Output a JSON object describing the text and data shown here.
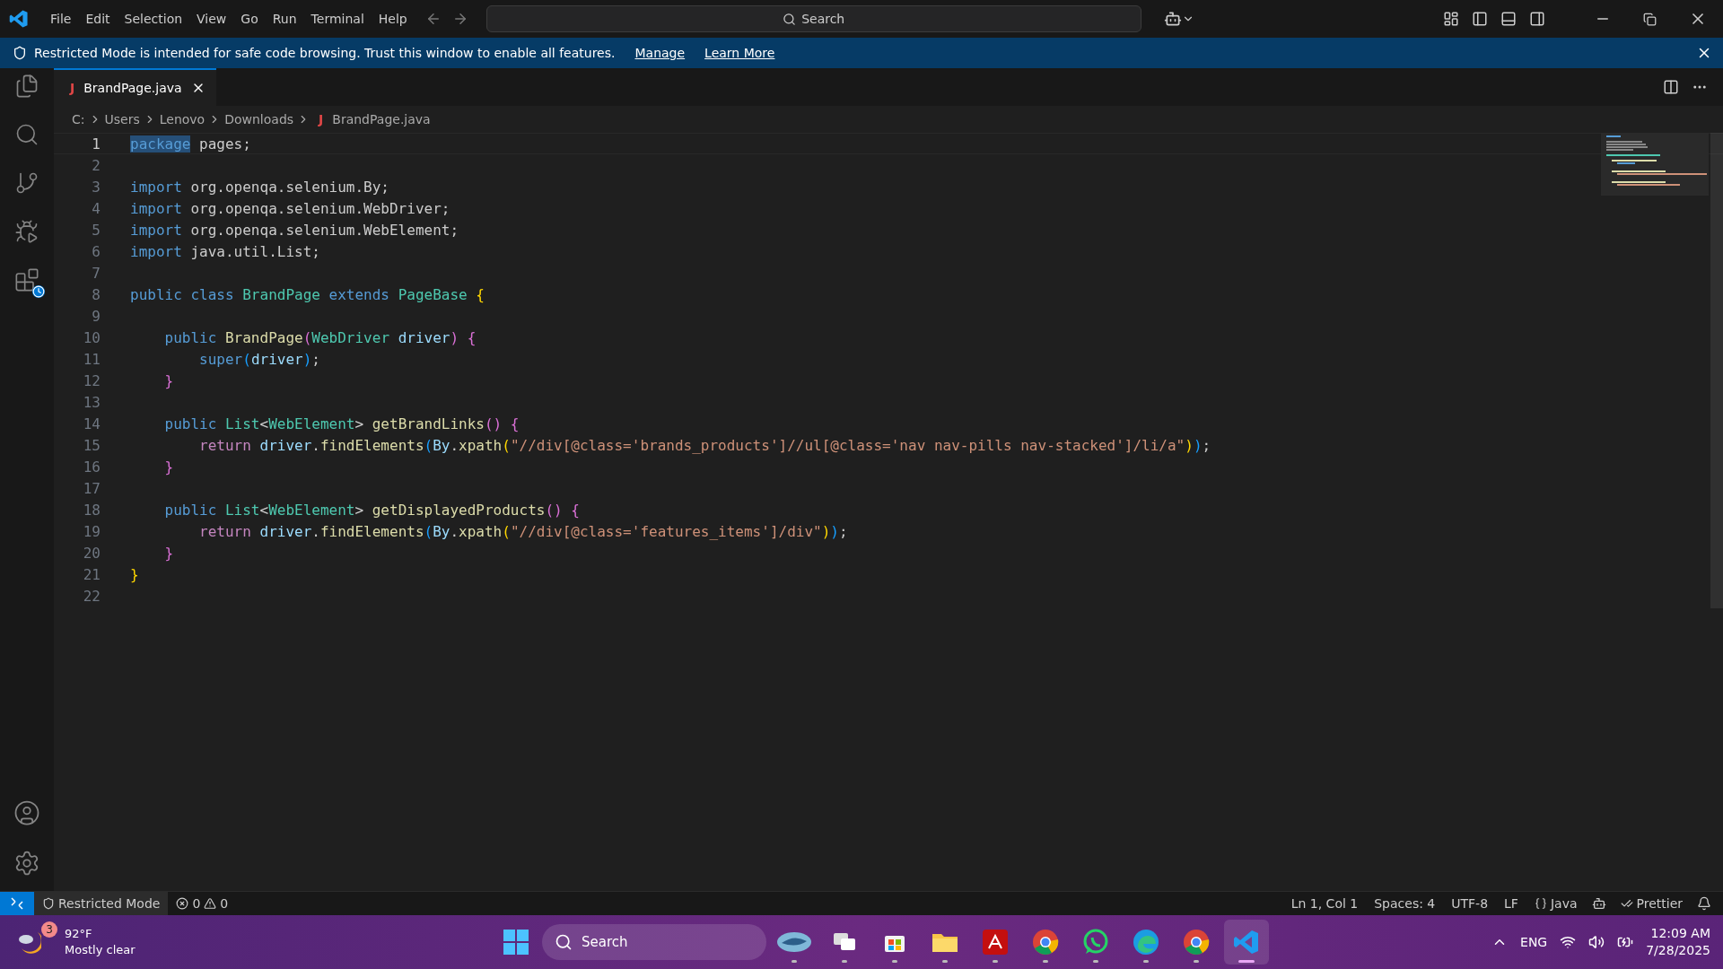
{
  "title_bar": {
    "menu": [
      "File",
      "Edit",
      "Selection",
      "View",
      "Go",
      "Run",
      "Terminal",
      "Help"
    ],
    "search": {
      "placeholder": "Search"
    }
  },
  "banner": {
    "message": "Restricted Mode is intended for safe code browsing. Trust this window to enable all features.",
    "links": [
      "Manage",
      "Learn More"
    ]
  },
  "tabs": [
    {
      "badge": "J",
      "label": "BrandPage.java",
      "selected": true
    }
  ],
  "breadcrumbs": {
    "folders": [
      "C:",
      "Users",
      "Lenovo",
      "Downloads"
    ],
    "file_badge": "J",
    "file": "BrandPage.java"
  },
  "editor": {
    "lines": [
      {
        "number": "1",
        "current": true,
        "tokens": [
          {
            "kind": "kw_sel",
            "text": "package"
          },
          {
            "kind": "pl",
            "text": " pages;"
          }
        ]
      },
      {
        "number": "2",
        "current": false
      },
      {
        "number": "3",
        "current": false,
        "tokens": [
          {
            "kind": "kw",
            "text": "import"
          },
          {
            "kind": "pl",
            "text": " org.openqa.selenium.By;"
          }
        ]
      },
      {
        "number": "4",
        "current": false,
        "tokens": [
          {
            "kind": "kw",
            "text": "import"
          },
          {
            "kind": "pl",
            "text": " org.openqa.selenium.WebDriver;"
          }
        ]
      },
      {
        "number": "5",
        "current": false,
        "tokens": [
          {
            "kind": "kw",
            "text": "import"
          },
          {
            "kind": "pl",
            "text": " org.openqa.selenium.WebElement;"
          }
        ]
      },
      {
        "number": "6",
        "current": false,
        "tokens": [
          {
            "kind": "kw",
            "text": "import"
          },
          {
            "kind": "pl",
            "text": " java.util.List;"
          }
        ]
      },
      {
        "number": "7",
        "current": false
      },
      {
        "number": "8",
        "current": false,
        "tokens": [
          {
            "kind": "kw",
            "text": "public class "
          },
          {
            "kind": "type",
            "text": "BrandPage"
          },
          {
            "kind": "kw",
            "text": " extends "
          },
          {
            "kind": "type",
            "text": "PageBase "
          },
          {
            "kind": "b1",
            "text": "{"
          }
        ]
      },
      {
        "number": "9",
        "current": false
      },
      {
        "number": "10",
        "current": false,
        "tokens": [
          {
            "kind": "kw",
            "text": "    public "
          },
          {
            "kind": "fn",
            "text": "BrandPage"
          },
          {
            "kind": "b2",
            "text": "("
          },
          {
            "kind": "type",
            "text": "WebDriver "
          },
          {
            "kind": "var",
            "text": "driver"
          },
          {
            "kind": "b2",
            "text": ") {"
          }
        ]
      },
      {
        "number": "11",
        "current": false,
        "tokens": [
          {
            "kind": "kw",
            "text": "        super"
          },
          {
            "kind": "b3",
            "text": "("
          },
          {
            "kind": "var",
            "text": "driver"
          },
          {
            "kind": "b3",
            "text": ")"
          },
          {
            "kind": "pl",
            "text": ";"
          }
        ]
      },
      {
        "number": "12",
        "current": false,
        "tokens": [
          {
            "kind": "b2",
            "text": "    }"
          }
        ]
      },
      {
        "number": "13",
        "current": false
      },
      {
        "number": "14",
        "current": false,
        "tokens": [
          {
            "kind": "kw",
            "text": "    public "
          },
          {
            "kind": "type",
            "text": "List"
          },
          {
            "kind": "pl",
            "text": "<"
          },
          {
            "kind": "type",
            "text": "WebElement"
          },
          {
            "kind": "pl",
            "text": "> "
          },
          {
            "kind": "fn",
            "text": "getBrandLinks"
          },
          {
            "kind": "b2",
            "text": "() {"
          }
        ]
      },
      {
        "number": "15",
        "current": false,
        "tokens": [
          {
            "kind": "ctl",
            "text": "        return "
          },
          {
            "kind": "var",
            "text": "driver"
          },
          {
            "kind": "pl",
            "text": "."
          },
          {
            "kind": "fn",
            "text": "findElements"
          },
          {
            "kind": "b3",
            "text": "("
          },
          {
            "kind": "var",
            "text": "By"
          },
          {
            "kind": "pl",
            "text": "."
          },
          {
            "kind": "fn",
            "text": "xpath"
          },
          {
            "kind": "b1",
            "text": "("
          },
          {
            "kind": "str",
            "text": "\"//div[@class='brands_products']//ul[@class='nav nav-pills nav-stacked']/li/a\""
          },
          {
            "kind": "b1",
            "text": ")"
          },
          {
            "kind": "b3",
            "text": ")"
          },
          {
            "kind": "pl",
            "text": ";"
          }
        ]
      },
      {
        "number": "16",
        "current": false,
        "tokens": [
          {
            "kind": "b2",
            "text": "    }"
          }
        ]
      },
      {
        "number": "17",
        "current": false
      },
      {
        "number": "18",
        "current": false,
        "tokens": [
          {
            "kind": "kw",
            "text": "    public "
          },
          {
            "kind": "type",
            "text": "List"
          },
          {
            "kind": "pl",
            "text": "<"
          },
          {
            "kind": "type",
            "text": "WebElement"
          },
          {
            "kind": "pl",
            "text": "> "
          },
          {
            "kind": "fn",
            "text": "getDisplayedProducts"
          },
          {
            "kind": "b2",
            "text": "() {"
          }
        ]
      },
      {
        "number": "19",
        "current": false,
        "tokens": [
          {
            "kind": "ctl",
            "text": "        return "
          },
          {
            "kind": "var",
            "text": "driver"
          },
          {
            "kind": "pl",
            "text": "."
          },
          {
            "kind": "fn",
            "text": "findElements"
          },
          {
            "kind": "b3",
            "text": "("
          },
          {
            "kind": "var",
            "text": "By"
          },
          {
            "kind": "pl",
            "text": "."
          },
          {
            "kind": "fn",
            "text": "xpath"
          },
          {
            "kind": "b1",
            "text": "("
          },
          {
            "kind": "str",
            "text": "\"//div[@class='features_items']/div\""
          },
          {
            "kind": "b1",
            "text": ")"
          },
          {
            "kind": "b3",
            "text": ")"
          },
          {
            "kind": "pl",
            "text": ";"
          }
        ]
      },
      {
        "number": "20",
        "current": false,
        "tokens": [
          {
            "kind": "b2",
            "text": "    }"
          }
        ]
      },
      {
        "number": "21",
        "current": false,
        "tokens": [
          {
            "kind": "b1",
            "text": "}"
          }
        ]
      },
      {
        "number": "22",
        "current": false
      }
    ]
  },
  "status_bar": {
    "restricted": "Restricted Mode",
    "errors": "0",
    "warnings": "0",
    "right": [
      "Ln 1, Col 1",
      "Spaces: 4",
      "UTF-8",
      "LF"
    ],
    "language": "Java",
    "formatter": "Prettier"
  },
  "taskbar": {
    "weather": {
      "badge": "3",
      "temperature": "92°F",
      "condition": "Mostly clear"
    },
    "search": {
      "placeholder": "Search"
    },
    "apps": [
      {
        "kind": "photo",
        "selected": false
      },
      {
        "kind": "taskview",
        "selected": false
      },
      {
        "kind": "store",
        "selected": false
      },
      {
        "kind": "folder",
        "selected": false
      },
      {
        "kind": "acrobat",
        "selected": false
      },
      {
        "kind": "chrome",
        "selected": false
      },
      {
        "kind": "whatsapp",
        "selected": false
      },
      {
        "kind": "edge",
        "selected": false
      },
      {
        "kind": "chrome",
        "selected": false
      },
      {
        "kind": "vscode",
        "selected": true
      }
    ],
    "tray": {
      "language": "ENG",
      "time": "12:09 AM",
      "date": "7/28/2025"
    }
  }
}
